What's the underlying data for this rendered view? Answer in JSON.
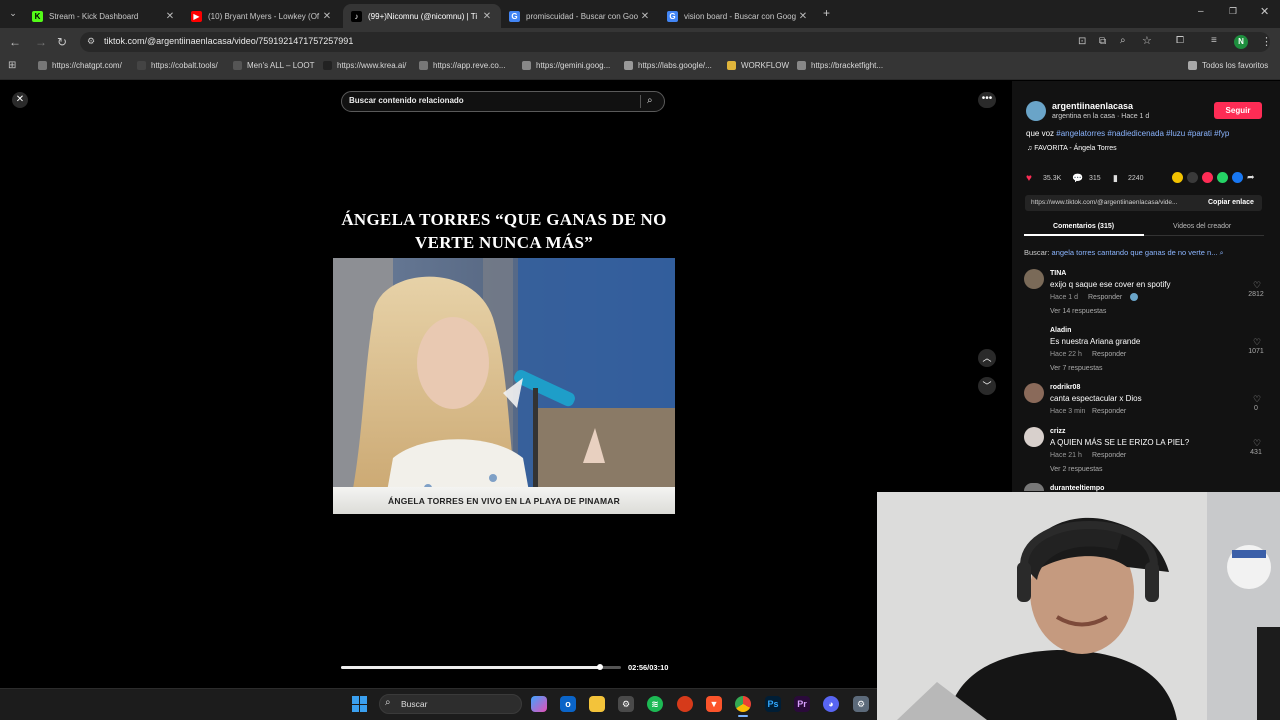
{
  "browser": {
    "tabs": [
      {
        "title": "Stream - Kick Dashboard",
        "favicon": "K",
        "color": "#53fc18"
      },
      {
        "title": "(10) Bryant Myers - Lowkey (Of",
        "favicon": "▶",
        "color": "#ff0000"
      },
      {
        "title": "(99+)Nicomnu (@nicomnu) | Ti",
        "favicon": "♪",
        "color": "#000000"
      },
      {
        "title": "promiscuidad - Buscar con Goo",
        "favicon": "G",
        "color": "#4285f4"
      },
      {
        "title": "vision board - Buscar con Goog",
        "favicon": "G",
        "color": "#4285f4"
      }
    ],
    "url": "tiktok.com/@argentiinaenlacasa/video/7591921471757257991",
    "profile_initial": "N",
    "bookmarks": [
      "https://chatgpt.com/",
      "https://cobalt.tools/",
      "Men's ALL – LOOT",
      "https://www.krea.ai/",
      "https://app.reve.co...",
      "https://gemini.goog...",
      "https://labs.google/...",
      "WORKFLOW",
      "https://bracketfight..."
    ],
    "bookmarks_folder": "Todos los favoritos"
  },
  "player": {
    "search_placeholder": "Buscar contenido relacionado",
    "headline": "ÁNGELA TORRES “QUE GANAS DE NO VERTE NUNCA MÁS”",
    "lower_third": "ÁNGELA TORRES EN VIVO EN LA PLAYA DE PINAMAR",
    "time": "02:56/03:10",
    "progress": 0.926
  },
  "post": {
    "username": "argentiinaenlacasa",
    "subtitle": "argentina en la casa · Hace 1 d",
    "follow_label": "Seguir",
    "caption_prefix": "que voz ",
    "hashtags": "#angelatorres #nadiedicenada #luzu #parati #fyp",
    "music": "FAVORITA - Ángela Torres",
    "likes": "35.3K",
    "comments_count": "315",
    "saves": "2240",
    "link": "https://www.tiktok.com/@argentiinaenlacasa/vide...",
    "copy_link_label": "Copiar enlace",
    "tab_comments": "Comentarios (315)",
    "tab_videos": "Videos del creador",
    "search_prefix": "Buscar:",
    "search_query": "angela torres cantando que ganas de no verte n..."
  },
  "comments": [
    {
      "user": "TINA",
      "text": "exijo q saque ese cover en spotify",
      "time": "Hace 1 d",
      "reply": "Responder",
      "likes": "2812",
      "more": "Ver 14 respuestas",
      "avatar": "#7a6a58"
    },
    {
      "user": "Aladin",
      "text": "Es nuestra Ariana grande",
      "time": "Hace 22 h",
      "reply": "Responder",
      "likes": "1071",
      "more": "Ver 7 respuestas",
      "avatar": "#121212"
    },
    {
      "user": "rodrikr08",
      "text": "canta espectacular x Dios",
      "time": "Hace 3 min",
      "reply": "Responder",
      "likes": "0",
      "more": "",
      "avatar": "#8a6a5a"
    },
    {
      "user": "crizz",
      "text": "A QUIEN MÁS SE LE ERIZO LA PIEL?",
      "time": "Hace 21 h",
      "reply": "Responder",
      "likes": "431",
      "more": "Ver 2 respuestas",
      "avatar": "#d8d0cc"
    },
    {
      "user": "duranteeltiempo",
      "text": "",
      "time": "",
      "reply": "",
      "likes": "",
      "more": "",
      "avatar": "#777777"
    }
  ],
  "taskbar": {
    "search_placeholder": "Buscar"
  }
}
